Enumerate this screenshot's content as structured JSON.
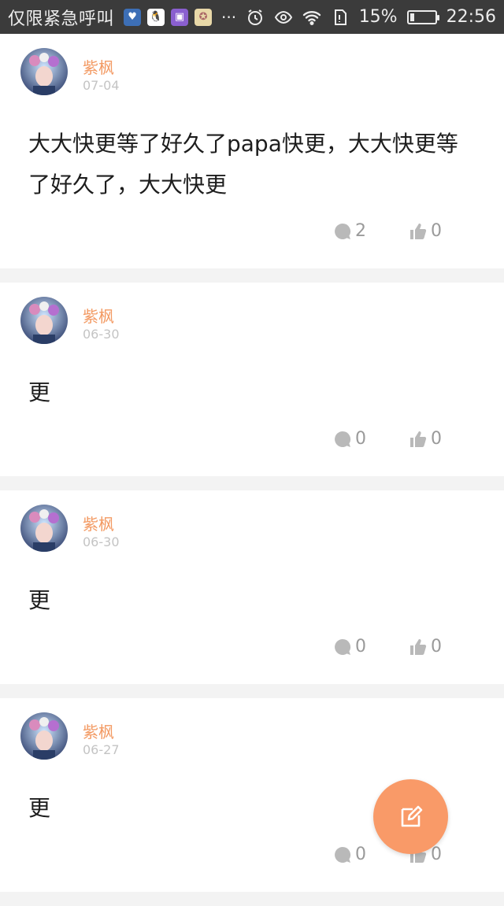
{
  "status_bar": {
    "carrier": "仅限紧急呼叫",
    "more": "···",
    "battery_percent": "15%",
    "battery_level": 0.15,
    "time": "22:56",
    "icons": [
      "app-blue-icon",
      "qq-icon",
      "app-purple-icon",
      "app-star-icon",
      "alarm-icon",
      "eye-icon",
      "wifi-icon",
      "sim-icon",
      "battery-icon"
    ]
  },
  "posts": [
    {
      "user": "紫枫",
      "date": "07-04",
      "text": "大大快更等了好久了papa快更，大大快更等了好久了，大大快更",
      "comments": "2",
      "likes": "0"
    },
    {
      "user": "紫枫",
      "date": "06-30",
      "text": "更",
      "comments": "0",
      "likes": "0"
    },
    {
      "user": "紫枫",
      "date": "06-30",
      "text": "更",
      "comments": "0",
      "likes": "0"
    },
    {
      "user": "紫枫",
      "date": "06-27",
      "text": "更",
      "comments": "0",
      "likes": "0"
    }
  ],
  "colors": {
    "accent": "#f39a63",
    "fab": "#f99a68",
    "statusbar": "#3b3b3b"
  },
  "fab_icon": "edit-icon"
}
